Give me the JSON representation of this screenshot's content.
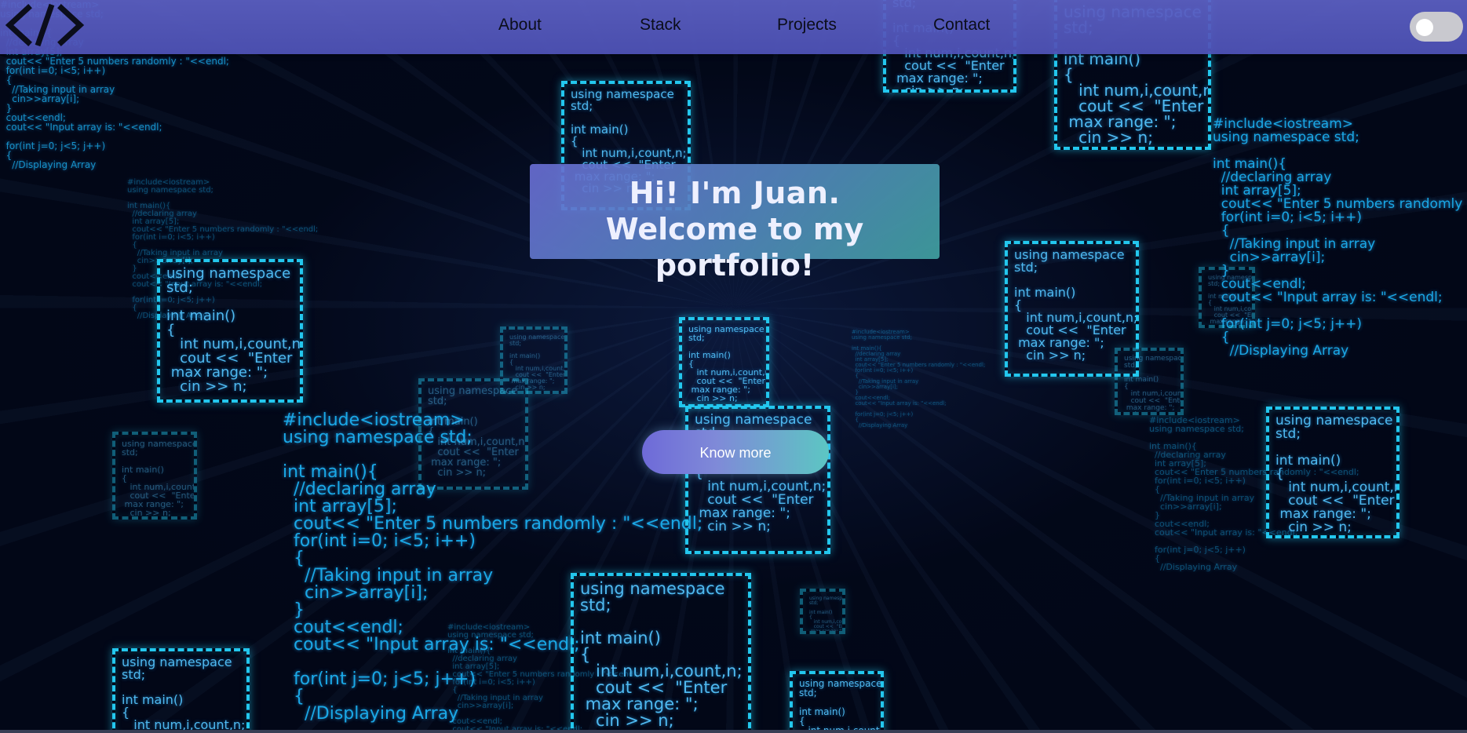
{
  "header": {
    "logo_text": "</>",
    "nav": {
      "about": "About",
      "stack": "Stack",
      "projects": "Projects",
      "contact": "Contact"
    },
    "theme_toggle": {
      "state": "off"
    }
  },
  "hero": {
    "greeting": "Hi! I'm Juan.",
    "welcome": "Welcome to my portfolio!",
    "button_label": "Know more"
  },
  "background": {
    "code_box": "using namespace\nstd;\n\nint main()\n{\n   int num,i,count,n;\n   cout <<  \"Enter\n max range: \";\n   cin >> n;",
    "code_block": "#include<iostream>\nusing namespace std;\n\nint main(){\n  //declaring array\n  int array[5];\n  cout<< \"Enter 5 numbers randomly : \"<<endl;\n  for(int i=0; i<5; i++)\n  {\n    //Taking input in array\n    cin>>array[i];\n  }\n  cout<<endl;\n  cout<< \"Input array is: \"<<endl;\n\n  for(int j=0; j<5; j++)\n  {\n    //Displaying Array"
  },
  "colors": {
    "header_bg": "#5c60c4",
    "code_cyan": "#23c7ee",
    "page_bg": "#020717"
  }
}
